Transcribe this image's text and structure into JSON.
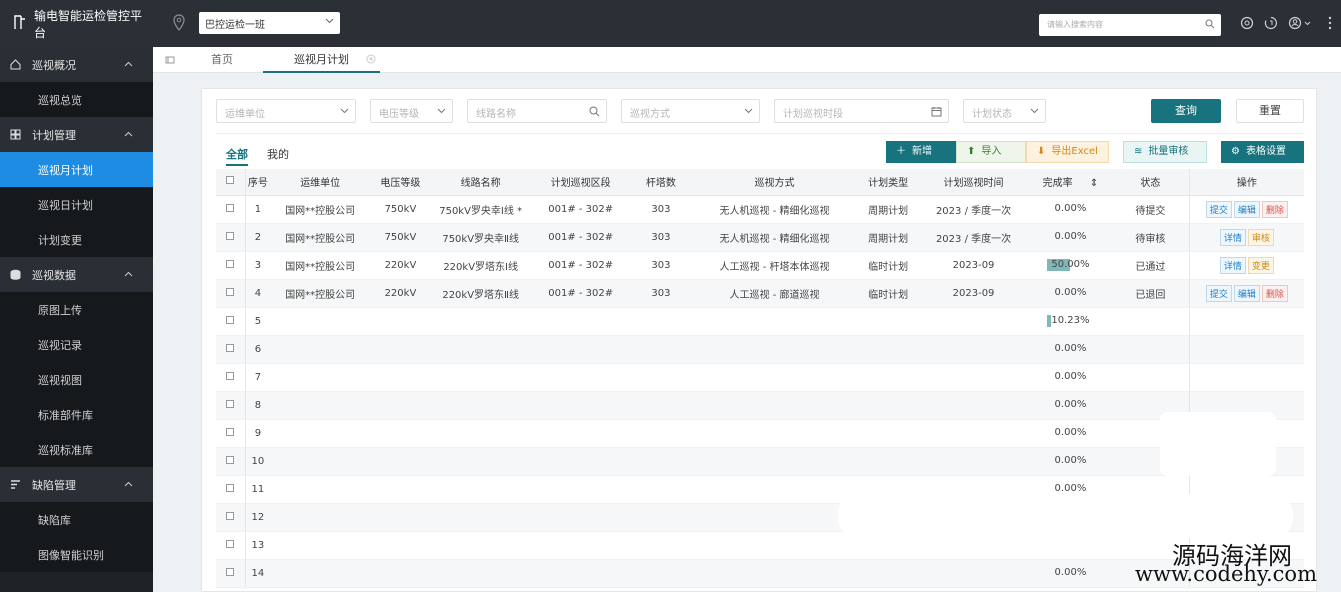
{
  "app": {
    "title": "输电智能运检管控平台"
  },
  "header": {
    "team_select": "巴控运检一班",
    "search_placeholder": "请输入搜索内容",
    "icons": [
      "settings-icon",
      "help-icon",
      "user-icon",
      "more-icon"
    ]
  },
  "sidebar": {
    "groups": [
      {
        "label": "巡视概况",
        "icon": "home-icon",
        "items": [
          "巡视总览"
        ]
      },
      {
        "label": "计划管理",
        "icon": "grid-icon",
        "items": [
          "巡视月计划",
          "巡视日计划",
          "计划变更"
        ]
      },
      {
        "label": "巡视数据",
        "icon": "database-icon",
        "items": [
          "原图上传",
          "巡视记录",
          "巡视视图",
          "标准部件库",
          "巡视标准库"
        ]
      },
      {
        "label": "缺陷管理",
        "icon": "list-icon",
        "items": [
          "缺陷库",
          "图像智能识别"
        ]
      }
    ],
    "active_item": "巡视月计划"
  },
  "tabs": {
    "home": "首页",
    "current": "巡视月计划"
  },
  "filters": {
    "unit": "运维单位",
    "voltage": "电压等级",
    "line": "线路名称",
    "mode": "巡视方式",
    "period": "计划巡视时段",
    "status": "计划状态"
  },
  "buttons": {
    "query": "查询",
    "reset": "重置",
    "add": "新增",
    "import": "导入",
    "export": "导出Excel",
    "batch": "批量审核",
    "table_settings": "表格设置"
  },
  "subtabs": {
    "all": "全部",
    "mine": "我的"
  },
  "table": {
    "headers": [
      "序号",
      "运维单位",
      "电压等级",
      "线路名称",
      "计划巡视区段",
      "杆塔数",
      "巡视方式",
      "计划类型",
      "计划巡视时间",
      "完成率",
      "状态",
      "操作"
    ],
    "rows": [
      {
        "no": "1",
        "unit": "国网**控股公司",
        "voltage": "750kV",
        "line": "750kV罗央幸Ⅰ线 *",
        "section": "001# - 302#",
        "towers": "303",
        "mode": "无人机巡视 - 精细化巡视",
        "type": "周期计划",
        "time": "2023 / 季度一次",
        "rate": "0.00%",
        "rate_value": 0,
        "status": "待提交",
        "ops": [
          "提交",
          "编辑",
          "删除"
        ]
      },
      {
        "no": "2",
        "unit": "国网**控股公司",
        "voltage": "750kV",
        "line": "750kV罗央幸Ⅱ线",
        "section": "001# - 302#",
        "towers": "303",
        "mode": "无人机巡视 - 精细化巡视",
        "type": "周期计划",
        "time": "2023 / 季度一次",
        "rate": "0.00%",
        "rate_value": 0,
        "status": "待审核",
        "ops": [
          "详情",
          "审核"
        ]
      },
      {
        "no": "3",
        "unit": "国网**控股公司",
        "voltage": "220kV",
        "line": "220kV罗塔东Ⅰ线",
        "section": "001# - 302#",
        "towers": "303",
        "mode": "人工巡视 - 杆塔本体巡视",
        "type": "临时计划",
        "time": "2023-09",
        "rate": "50.00%",
        "rate_value": 0.5,
        "status": "已通过",
        "ops": [
          "详情",
          "变更"
        ]
      },
      {
        "no": "4",
        "unit": "国网**控股公司",
        "voltage": "220kV",
        "line": "220kV罗塔东Ⅱ线",
        "section": "001# - 302#",
        "towers": "303",
        "mode": "人工巡视 - 廊道巡视",
        "type": "临时计划",
        "time": "2023-09",
        "rate": "0.00%",
        "rate_value": 0,
        "status": "已退回",
        "ops": [
          "提交",
          "编辑",
          "删除"
        ]
      },
      {
        "no": "5",
        "rate": "10.23%",
        "rate_value": 0.1023
      },
      {
        "no": "6",
        "rate": "0.00%",
        "rate_value": 0
      },
      {
        "no": "7",
        "rate": "0.00%",
        "rate_value": 0
      },
      {
        "no": "8",
        "rate": "0.00%",
        "rate_value": 0
      },
      {
        "no": "9",
        "rate": "0.00%",
        "rate_value": 0
      },
      {
        "no": "10",
        "rate": "0.00%",
        "rate_value": 0
      },
      {
        "no": "11",
        "rate": "0.00%",
        "rate_value": 0
      },
      {
        "no": "12",
        "rate": "",
        "rate_value": 0
      },
      {
        "no": "13",
        "rate": "",
        "rate_value": 0
      },
      {
        "no": "14",
        "rate": "0.00%",
        "rate_value": 0
      }
    ]
  },
  "watermark": {
    "line1": "源码海洋网",
    "line2": "www.codehy.com"
  },
  "colors": {
    "accent": "#17737d",
    "sidebar_active": "#1e8ce2",
    "topbar": "#2b3036",
    "sidebar": "#1d2226"
  }
}
